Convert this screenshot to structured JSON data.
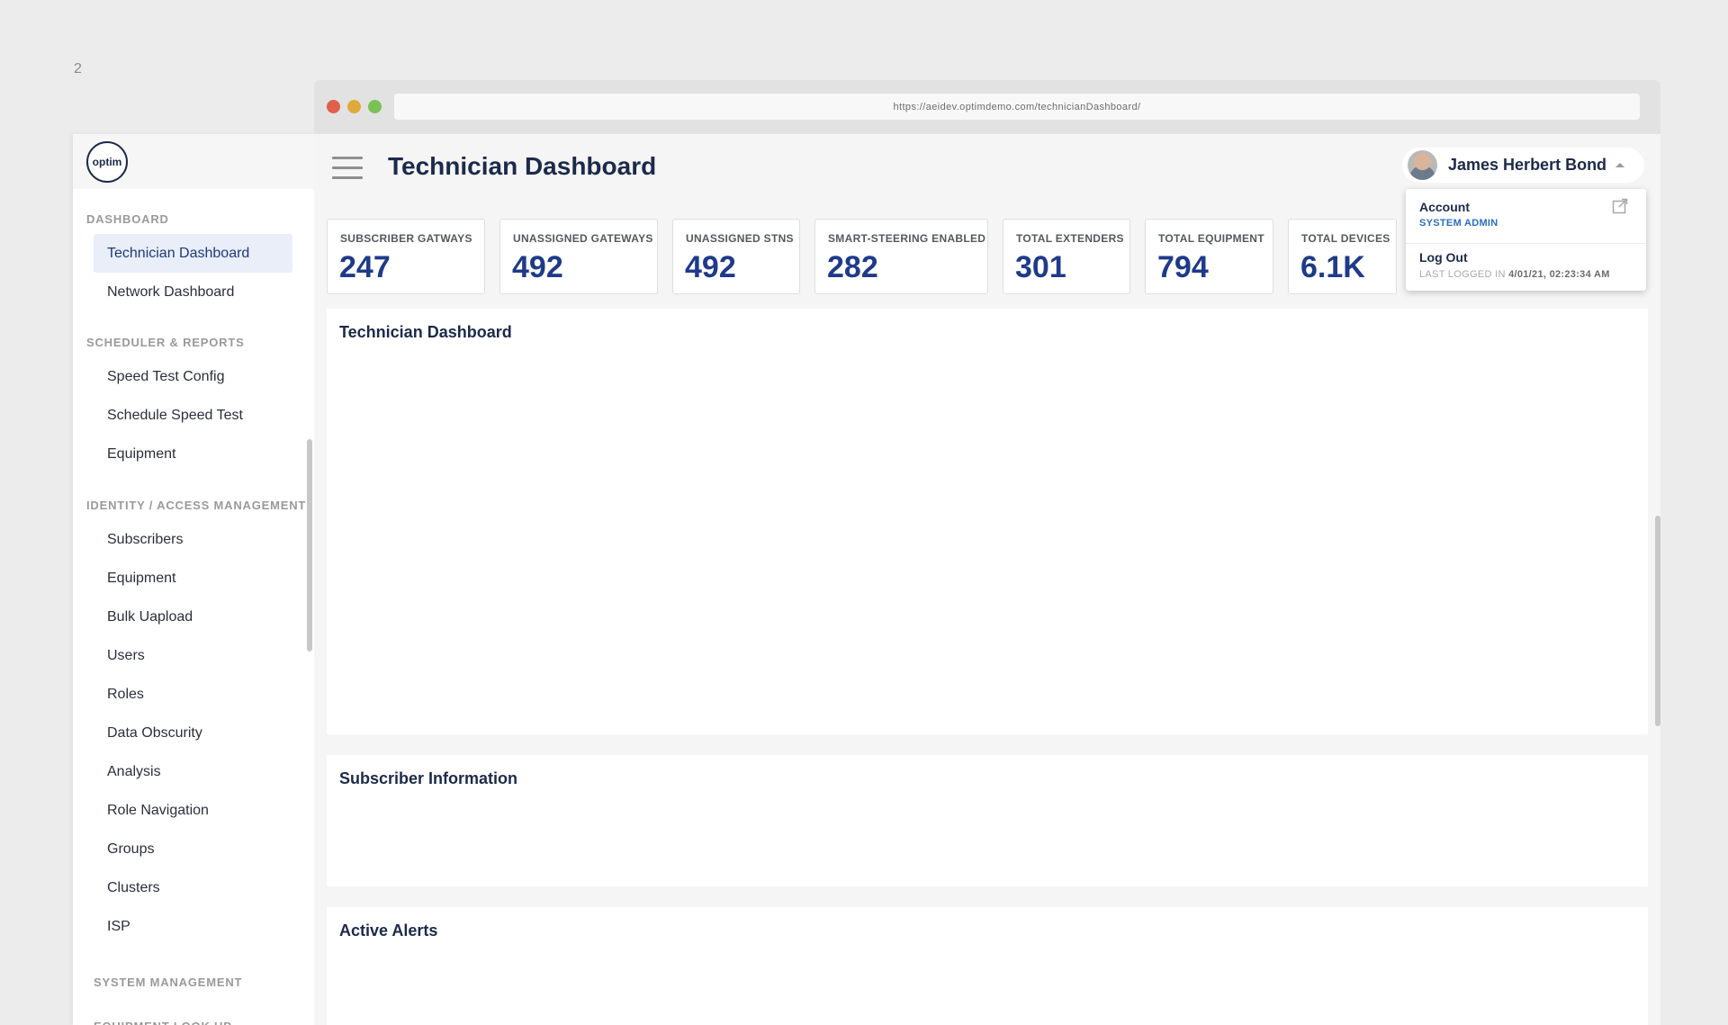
{
  "page_number": "2",
  "browser": {
    "url": "https://aeidev.optimdemo.com/technicianDashboard/"
  },
  "sidebar": {
    "logo_text": "optim",
    "sections": [
      {
        "title": "DASHBOARD",
        "items": [
          "Technician Dashboard",
          "Network Dashboard"
        ]
      },
      {
        "title": "SCHEDULER & REPORTS",
        "items": [
          "Speed Test Config",
          "Schedule Speed Test",
          "Equipment"
        ]
      },
      {
        "title": "IDENTITY / ACCESS MANAGEMENT",
        "items": [
          "Subscribers",
          "Equipment",
          "Bulk Uapload",
          "Users",
          "Roles",
          "Data Obscurity",
          "Analysis",
          "Role Navigation",
          "Groups",
          "Clusters",
          "ISP"
        ]
      },
      {
        "title": "SYSTEM MANAGEMENT",
        "items": []
      },
      {
        "title": "EQUIPMENT LOOK UP",
        "items": []
      }
    ],
    "active_item": "Technician Dashboard"
  },
  "header": {
    "title": "Technician Dashboard",
    "user_name": "James Herbert Bond"
  },
  "user_menu": {
    "account_label": "Account",
    "role": "SYSTEM ADMIN",
    "logout_label": "Log Out",
    "last_logged_prefix": "LAST LOGGED IN",
    "last_logged_value": "4/01/21, 02:23:34 AM"
  },
  "kpis": [
    {
      "label": "SUBSCRIBER GATWAYS",
      "value": "247"
    },
    {
      "label": "UNASSIGNED GATEWAYS",
      "value": "492"
    },
    {
      "label": "UNASSIGNED STNS",
      "value": "492"
    },
    {
      "label": "SMART-STEERING ENABLED",
      "value": "282"
    },
    {
      "label": "TOTAL EXTENDERS",
      "value": "301"
    },
    {
      "label": "TOTAL EQUIPMENT",
      "value": "794"
    },
    {
      "label": "TOTAL DEVICES",
      "value": "6.1K"
    }
  ],
  "cards": {
    "technician_dashboard": "Technician Dashboard",
    "subscriber_information": "Subscriber Information",
    "active_alerts": "Active Alerts"
  },
  "colors": {
    "primary_text": "#1c2a4a",
    "kpi_value": "#1f3a8a",
    "role_link": "#2b6fc4",
    "active_nav_bg": "#e9eef9"
  }
}
